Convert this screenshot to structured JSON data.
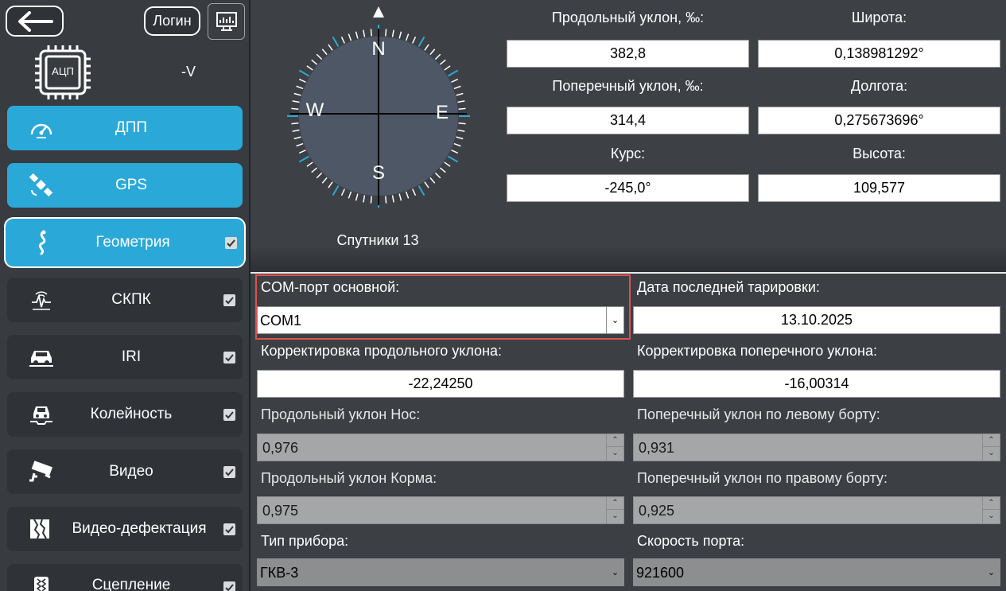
{
  "sidebar": {
    "back_label": "←",
    "login_label": "Логин",
    "adc_label": "АЦП",
    "voltage": "-V",
    "items": [
      {
        "label": "ДПП",
        "icon": "speedometer-icon",
        "state": "active"
      },
      {
        "label": "GPS",
        "icon": "satellite-icon",
        "state": "active"
      },
      {
        "label": "Геометрия",
        "icon": "road-curve-icon",
        "state": "selected",
        "checked": true
      },
      {
        "label": "СКПК",
        "icon": "wave-sensor-icon",
        "checked": true
      },
      {
        "label": "IRI",
        "icon": "car-front-icon",
        "checked": true
      },
      {
        "label": "Колейность",
        "icon": "car-rut-icon",
        "checked": true
      },
      {
        "label": "Видео",
        "icon": "camera-icon",
        "checked": true
      },
      {
        "label": "Видео-дефектация",
        "icon": "crack-icon",
        "checked": true
      },
      {
        "label": "Сцепление",
        "icon": "tire-icon",
        "checked": true
      }
    ]
  },
  "compass": {
    "north": "N",
    "south": "S",
    "east": "E",
    "west": "W",
    "satellites": "Спутники 13"
  },
  "readouts": {
    "long_slope_label": "Продольный уклон, ‰:",
    "long_slope_value": "382,8",
    "cross_slope_label": "Поперечный уклон, ‰:",
    "cross_slope_value": "314,4",
    "course_label": "Курс:",
    "course_value": "-245,0°",
    "latitude_label": "Широта:",
    "latitude_value": "0,138981292°",
    "longitude_label": "Долгота:",
    "longitude_value": "0,275673696°",
    "altitude_label": "Высота:",
    "altitude_value": "109,577"
  },
  "settings": {
    "com_port_label": "COM-порт основной:",
    "com_port_value": "COM1",
    "calib_date_label": "Дата последней тарировки:",
    "calib_date_value": "13.10.2025",
    "long_corr_label": "Корректировка продольного уклона:",
    "long_corr_value": "-22,24250",
    "cross_corr_label": "Корректировка поперечного уклона:",
    "cross_corr_value": "-16,00314",
    "long_nose_label": "Продольный уклон Нос:",
    "long_nose_value": "0,976",
    "cross_left_label": "Поперечный уклон по левому борту:",
    "cross_left_value": "0,931",
    "long_stern_label": "Продольный уклон Корма:",
    "long_stern_value": "0,975",
    "cross_right_label": "Поперечный уклон по правому борту:",
    "cross_right_value": "0,925",
    "device_type_label": "Тип прибора:",
    "device_type_value": "ГКВ-3",
    "port_speed_label": "Скорость порта:",
    "port_speed_value": "921600"
  },
  "colors": {
    "accent": "#2aa9d9",
    "highlight_frame": "#d9534f"
  }
}
